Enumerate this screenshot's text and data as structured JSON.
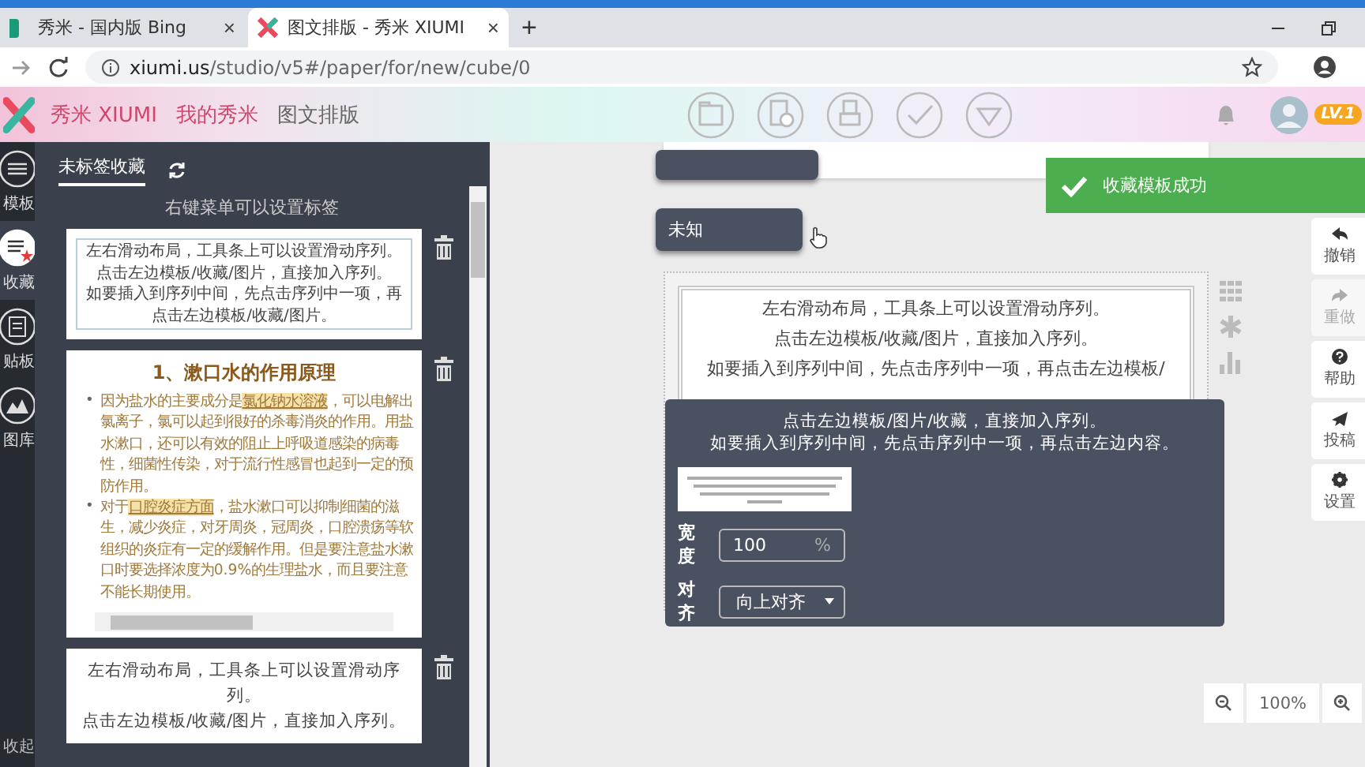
{
  "browser": {
    "tabs": [
      {
        "title": "秀米 - 国内版 Bing",
        "close": "×",
        "selected": false
      },
      {
        "title": "图文排版 - 秀米 XIUMI",
        "close": "×",
        "selected": true
      }
    ],
    "new_tab": "+",
    "url_host": "xiumi.us",
    "url_path": "/studio/v5#/paper/for/new/cube/0"
  },
  "header": {
    "breadcrumbs": [
      "秀米 XIUMI",
      "我的秀米",
      "图文排版"
    ],
    "level_badge": "LV.1"
  },
  "nav": {
    "items": [
      {
        "kind": "templates",
        "label": "模板",
        "selected": false
      },
      {
        "kind": "favorites",
        "label": "收藏",
        "selected": true
      },
      {
        "kind": "clipboard",
        "label": "贴板",
        "selected": false
      },
      {
        "kind": "gallery",
        "label": "图库",
        "selected": false
      }
    ],
    "collapse": "收起"
  },
  "panel": {
    "tab": "未标签收藏",
    "hint": "右键菜单可以设置标签",
    "cards": [
      {
        "kind": "boxed",
        "lines": [
          "左右滑动布局，工具条上可以设置滑动序列。",
          "点击左边模板/收藏/图片，直接加入序列。",
          "如要插入到序列中间，先点击序列中一项，再点击左边模板/收藏/图片。"
        ]
      },
      {
        "kind": "article",
        "title": "1、漱口水的作用原理",
        "bullets": [
          {
            "marker": "•",
            "text": "因为盐水的主要成分是**氯化钠水溶液**，可以电解出氯离子，氯可以起到很好的杀毒消炎的作用。用盐水漱口，还可以有效的阻止上呼吸道感染的病毒性，细菌性传染，对于流行性感冒也起到一定的预防作用。"
          },
          {
            "marker": "•",
            "text": "对于**口腔炎症方面**，盐水漱口可以抑制细菌的滋生，减少炎症，对牙周炎，冠周炎，口腔溃疡等软组织的炎症有一定的缓解作用。但是要注意盐水漱口时要选择浓度为0.9%的生理盐水，而且要注意不能长期使用。"
          }
        ]
      },
      {
        "kind": "plain",
        "lines": [
          "左右滑动布局，工具条上可以设置滑动序列。",
          "点击左边模板/收藏/图片，直接加入序列。"
        ]
      }
    ]
  },
  "canvas": {
    "floating_button": "未知",
    "toast": "收藏模板成功",
    "editor_lines": [
      "左右滑动布局，工具条上可以设置滑动序列。",
      "点击左边模板/收藏/图片，直接加入序列。",
      "如要插入到序列中间，先点击序列中一项，再点击左边模板/"
    ],
    "popup": {
      "lines": [
        "点击左边模板/图片/收藏，直接加入序列。",
        "如要插入到序列中间，先点击序列中一项，再点击左边内容。"
      ],
      "width_label": "宽度",
      "width_value": "100",
      "width_unit": "%",
      "align_label": "对齐",
      "align_value": "向上对齐"
    },
    "side_buttons": [
      {
        "kind": "undo",
        "label": "撤销",
        "disabled": false
      },
      {
        "kind": "redo",
        "label": "重做",
        "disabled": true
      },
      {
        "kind": "help",
        "label": "帮助",
        "disabled": false
      },
      {
        "kind": "submit",
        "label": "投稿",
        "disabled": false
      },
      {
        "kind": "settings",
        "label": "设置",
        "disabled": false
      }
    ],
    "zoom": "100%"
  }
}
